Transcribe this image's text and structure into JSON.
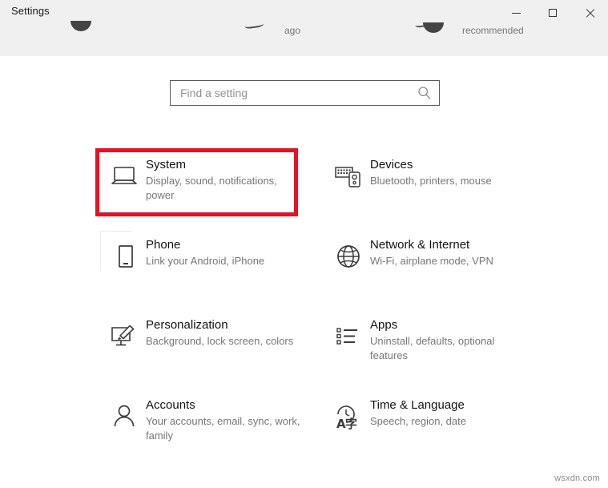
{
  "window": {
    "title": "Settings",
    "minimize_label": "Minimize",
    "maximize_label": "Maximize",
    "close_label": "Close"
  },
  "top_strip": {
    "fragment_text_1": "ago",
    "fragment_text_2": "recommended"
  },
  "search": {
    "placeholder": "Find a setting",
    "value": "",
    "icon": "search-icon"
  },
  "highlight": {
    "color": "#e81123",
    "target": "System"
  },
  "tiles": [
    {
      "title": "System",
      "subtitle": "Display, sound, notifications, power",
      "icon": "laptop-icon"
    },
    {
      "title": "Devices",
      "subtitle": "Bluetooth, printers, mouse",
      "icon": "keyboard-mouse-icon"
    },
    {
      "title": "Phone",
      "subtitle": "Link your Android, iPhone",
      "icon": "phone-icon"
    },
    {
      "title": "Network & Internet",
      "subtitle": "Wi-Fi, airplane mode, VPN",
      "icon": "globe-icon"
    },
    {
      "title": "Personalization",
      "subtitle": "Background, lock screen, colors",
      "icon": "paintbrush-monitor-icon"
    },
    {
      "title": "Apps",
      "subtitle": "Uninstall, defaults, optional features",
      "icon": "list-icon"
    },
    {
      "title": "Accounts",
      "subtitle": "Your accounts, email, sync, work, family",
      "icon": "person-icon"
    },
    {
      "title": "Time & Language",
      "subtitle": "Speech, region, date",
      "icon": "clock-language-icon"
    }
  ],
  "watermark": {
    "text": "wsxdn.com"
  },
  "colors": {
    "header_bg": "#f0f0f0",
    "page_bg": "#ffffff",
    "title_text": "#121212",
    "subtitle_text": "#767676",
    "highlight_red": "#e81123"
  }
}
